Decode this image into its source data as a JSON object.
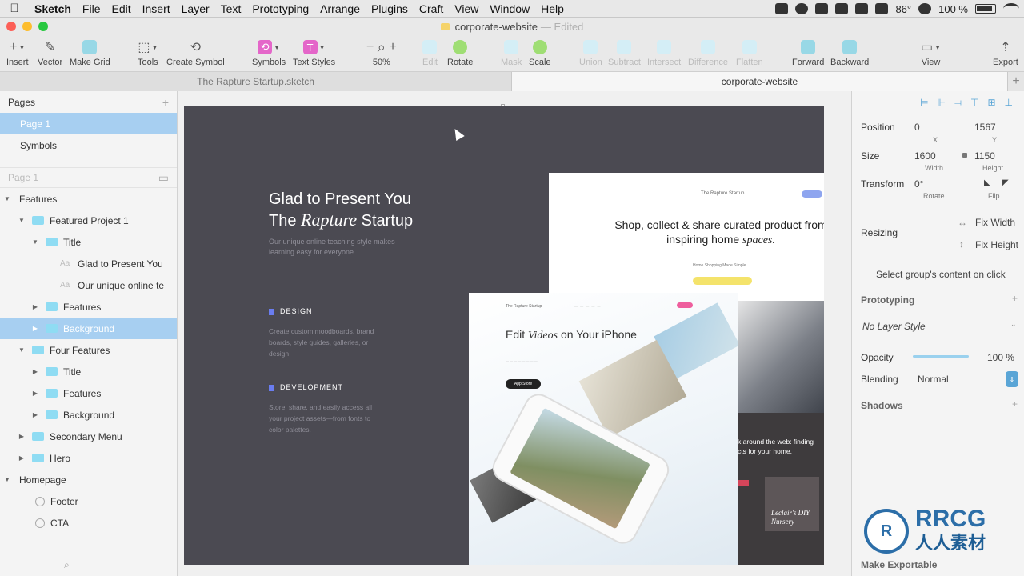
{
  "menubar": {
    "app": "Sketch",
    "items": [
      "File",
      "Edit",
      "Insert",
      "Layer",
      "Text",
      "Prototyping",
      "Arrange",
      "Plugins",
      "Craft",
      "View",
      "Window",
      "Help"
    ],
    "temperature": "86°",
    "battery": "100 %"
  },
  "window": {
    "title": "corporate-website",
    "edited": "— Edited"
  },
  "toolbar": {
    "insert": "Insert",
    "vector": "Vector",
    "make_grid": "Make Grid",
    "tools": "Tools",
    "create_symbol": "Create Symbol",
    "symbols": "Symbols",
    "text_styles": "Text Styles",
    "zoom": "50%",
    "edit": "Edit",
    "rotate": "Rotate",
    "mask": "Mask",
    "scale": "Scale",
    "union": "Union",
    "subtract": "Subtract",
    "intersect": "Intersect",
    "difference": "Difference",
    "flatten": "Flatten",
    "forward": "Forward",
    "backward": "Backward",
    "view": "View",
    "export": "Export"
  },
  "tabs": [
    "The Rapture Startup.sketch",
    "corporate-website"
  ],
  "pages": {
    "header": "Pages",
    "items": [
      "Page 1",
      "Symbols"
    ],
    "filter": "Page 1"
  },
  "layers": [
    {
      "label": "Features"
    },
    {
      "label": "Featured Project 1"
    },
    {
      "label": "Title"
    },
    {
      "label": "Glad to Present You"
    },
    {
      "label": "Our unique online te"
    },
    {
      "label": "Features"
    },
    {
      "label": "Background"
    },
    {
      "label": "Four Features"
    },
    {
      "label": "Title"
    },
    {
      "label": "Features"
    },
    {
      "label": "Background"
    },
    {
      "label": "Secondary Menu"
    },
    {
      "label": "Hero"
    },
    {
      "label": "Homepage"
    },
    {
      "label": "Footer"
    },
    {
      "label": "CTA"
    }
  ],
  "artboard": {
    "title_line1": "Glad to Present You",
    "title_line2_pre": "The ",
    "title_line2_em": "Rapture",
    "title_line2_post": " Startup",
    "subtitle": "Our unique online teaching style makes learning easy for everyone",
    "design_label": "DESIGN",
    "design_desc": "Create custom moodboards, brand boards, style guides, galleries, or design",
    "dev_label": "DEVELOPMENT",
    "dev_desc": "Store, share, and easily access all your project assets—from fonts to color palettes.",
    "m1_brand": "The Rapture Startup",
    "m1_headline_pre": "Shop, collect & share curated product from inspiring home ",
    "m1_headline_em": "spaces.",
    "m1_small": "Home Shopping Made Simple",
    "m1_dark_text": "k around the web: finding cts for your home.",
    "m1_card": "Leclair's DIY Nursery",
    "m2_brand": "The Rapture Startup",
    "m2_headline_pre": "Edit ",
    "m2_headline_em": "Videos",
    "m2_headline_post": " on Your iPhone",
    "m2_appstore": "App Store"
  },
  "inspector": {
    "position_label": "Position",
    "x": "0",
    "y": "1567",
    "x_cap": "X",
    "y_cap": "Y",
    "size_label": "Size",
    "width": "1600",
    "height": "1150",
    "w_cap": "Width",
    "h_cap": "Height",
    "transform_label": "Transform",
    "rotate_val": "0°",
    "rotate_cap": "Rotate",
    "flip_cap": "Flip",
    "resizing_label": "Resizing",
    "fix_width": "Fix Width",
    "fix_height": "Fix Height",
    "select_group": "Select group's content on click",
    "prototyping": "Prototyping",
    "layer_style": "No Layer Style",
    "opacity_label": "Opacity",
    "opacity": "100 %",
    "blending_label": "Blending",
    "blending": "Normal",
    "shadows": "Shadows",
    "make_exportable": "Make Exportable"
  },
  "watermark": {
    "logo": "RRCG",
    "subtitle": "人人素材"
  },
  "colors": {
    "accent": "#a7cff1",
    "folder": "#8fdcf3",
    "artboard": "#4b4a52"
  }
}
